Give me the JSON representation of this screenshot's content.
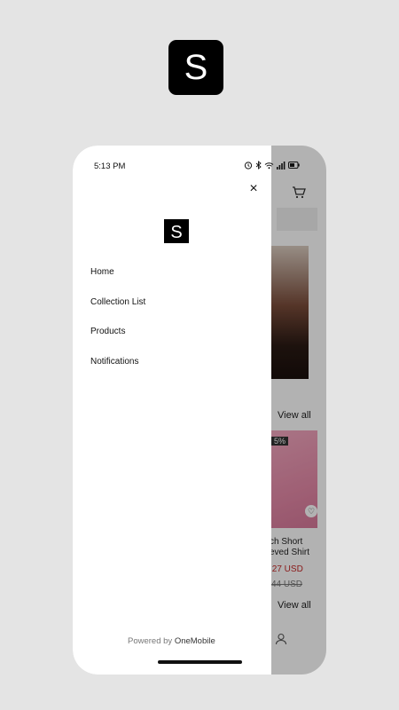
{
  "app_icon": {
    "letter": "S"
  },
  "status_bar": {
    "time": "5:13 PM"
  },
  "drawer": {
    "logo_letter": "S",
    "close_label": "×",
    "menu_items": [
      "Home",
      "Collection List",
      "Products",
      "Notifications"
    ],
    "powered_by": {
      "prefix": "Powered by",
      "brand": "OneMobile"
    }
  },
  "background": {
    "view_all_1": "View all",
    "badge": "5%",
    "product_name": "ch Short\neved Shirt",
    "price": ".27 USD",
    "old_price": "44 USD",
    "view_all_2": "View all"
  },
  "colors": {
    "accent": "#000000",
    "sale": "#c62828",
    "overlay": "rgba(0,0,0,0.30)"
  }
}
